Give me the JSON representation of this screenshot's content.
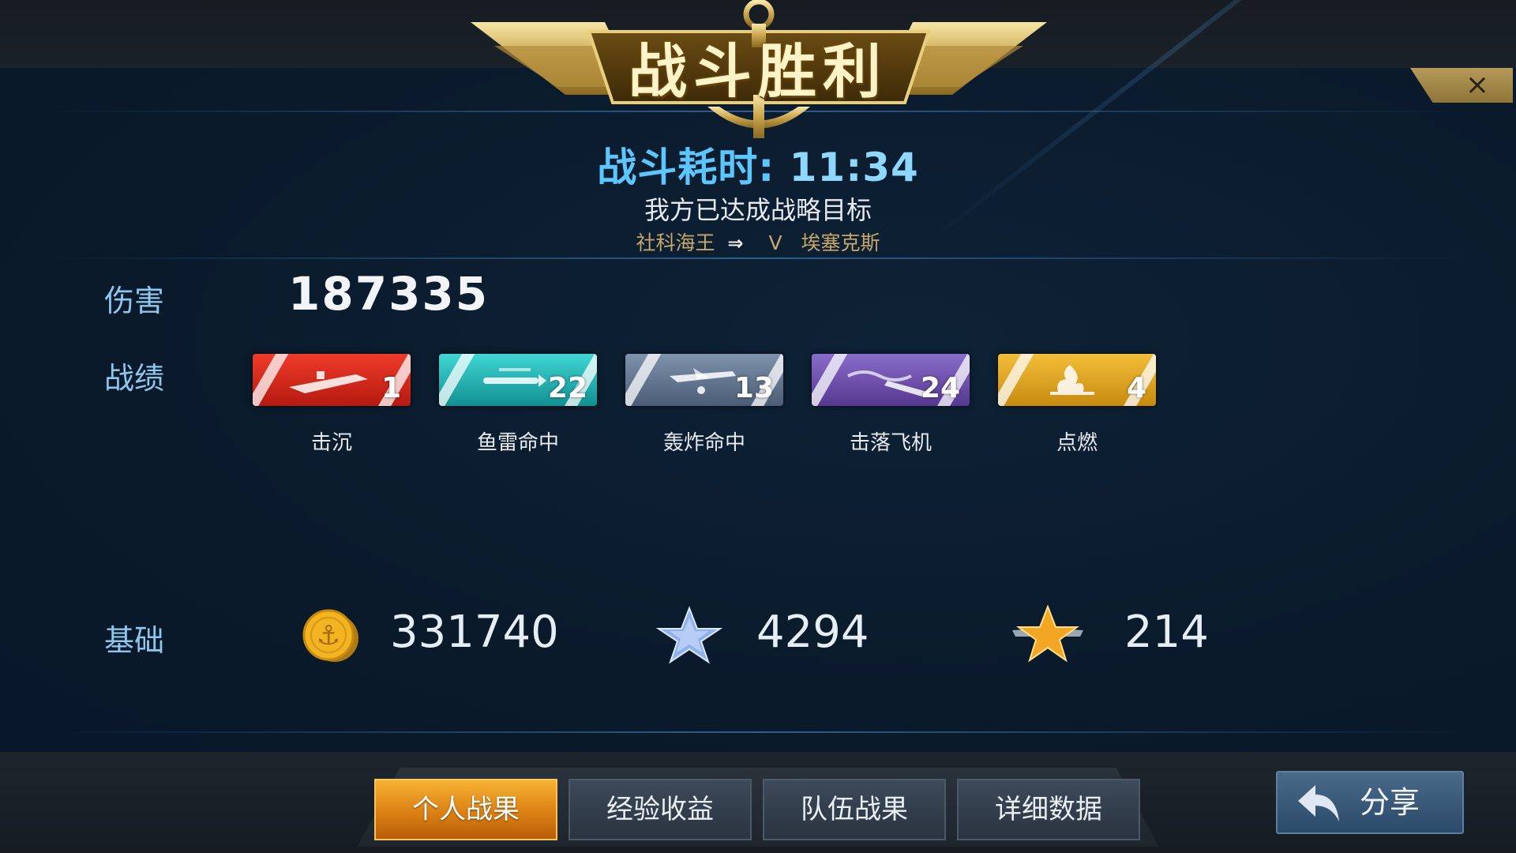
{
  "header": {
    "title": "战斗胜利",
    "close_label": "×"
  },
  "battle": {
    "duration_label": "战斗耗时:",
    "duration_value": "11:34",
    "objective": "我方已达成战略目标",
    "ship_a": "社科海王",
    "versus": "V",
    "ship_b": "埃塞克斯"
  },
  "damage": {
    "label": "伤害",
    "value": "187335"
  },
  "record": {
    "label": "战绩",
    "medals": [
      {
        "label": "击沉",
        "count": "1",
        "color": "#d8261c",
        "icon": "sinking-ship-icon"
      },
      {
        "label": "鱼雷命中",
        "count": "22",
        "color": "#1fb3b3",
        "icon": "torpedo-icon"
      },
      {
        "label": "轰炸命中",
        "count": "13",
        "color": "#5e728c",
        "icon": "bomber-icon"
      },
      {
        "label": "击落飞机",
        "count": "24",
        "color": "#6b4ea6",
        "icon": "downed-plane-icon"
      },
      {
        "label": "点燃",
        "count": "4",
        "color": "#e0a21f",
        "icon": "fire-icon"
      }
    ]
  },
  "basic": {
    "label": "基础",
    "coins": "331740",
    "experience": "4294",
    "rank_points": "214"
  },
  "tabs": [
    "个人战果",
    "经验收益",
    "队伍战果",
    "详细数据"
  ],
  "active_tab": 0,
  "share_label": "分享"
}
